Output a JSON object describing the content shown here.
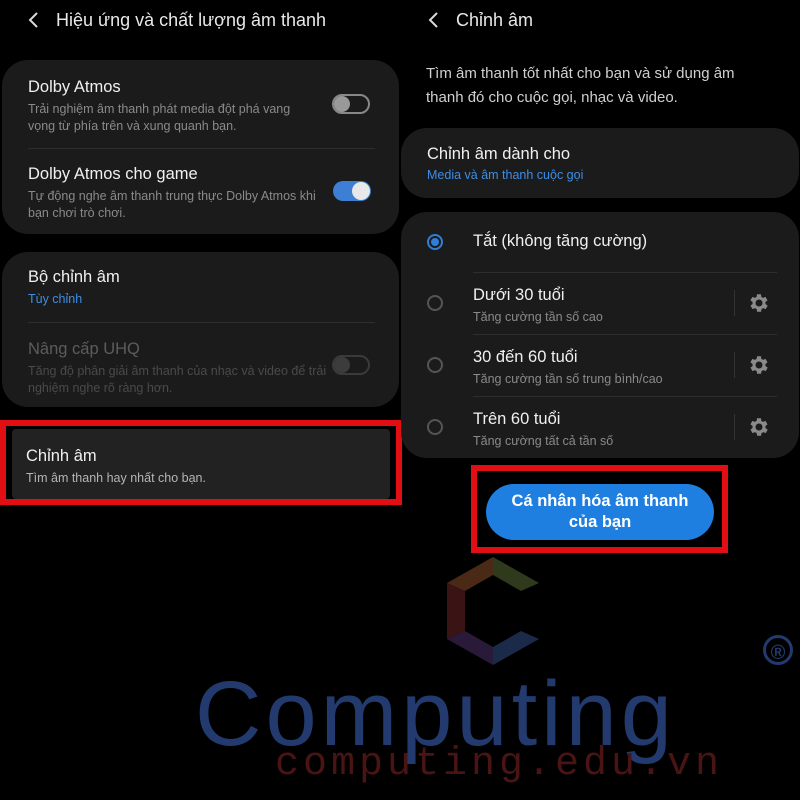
{
  "left": {
    "header": {
      "title": "Hiệu ứng và chất lượng âm thanh"
    },
    "dolby_card": {
      "items": [
        {
          "title": "Dolby Atmos",
          "subtitle": "Trải nghiệm âm thanh phát media đột phá vang vọng từ phía trên và xung quanh bạn.",
          "toggle": "off"
        },
        {
          "title": "Dolby Atmos cho game",
          "subtitle": "Tự động nghe âm thanh trung thực Dolby Atmos khi bạn chơi trò chơi.",
          "toggle": "on"
        }
      ]
    },
    "eq_card": {
      "items": [
        {
          "title": "Bộ chỉnh âm",
          "value": "Tùy chỉnh"
        },
        {
          "title": "Nâng cấp UHQ",
          "subtitle": "Tăng độ phân giải âm thanh của nhạc và video để trải nghiệm nghe rõ ràng hơn.",
          "toggle": "disabled"
        }
      ]
    },
    "highlight_item": {
      "title": "Chỉnh âm",
      "subtitle": "Tìm âm thanh hay nhất cho bạn."
    }
  },
  "right": {
    "header": {
      "title": "Chỉnh âm"
    },
    "description": "Tìm âm thanh tốt nhất cho bạn và sử dụng âm thanh đó cho cuộc gọi, nhạc và video.",
    "target_card": {
      "title": "Chỉnh âm dành cho",
      "value": "Media và âm thanh cuộc gọi"
    },
    "options": [
      {
        "label": "Tắt (không tăng cường)",
        "selected": true
      },
      {
        "label": "Dưới 30 tuổi",
        "subtitle": "Tăng cường tần số cao",
        "selected": false
      },
      {
        "label": "30 đến 60 tuổi",
        "subtitle": "Tăng cường tần số trung bình/cao",
        "selected": false
      },
      {
        "label": "Trên 60 tuổi",
        "subtitle": "Tăng cường tất cả tần số",
        "selected": false
      }
    ],
    "personalize_button": "Cá nhân hóa âm thanh của bạn"
  },
  "watermark": {
    "brand": "Computing",
    "registered": "®",
    "url": "computing.edu.vn"
  },
  "colors": {
    "accent": "#1e7fe0",
    "highlight_frame": "#e10f14",
    "card": "#1b1b1b",
    "watermark_blue": "#233a6e"
  },
  "icons": {
    "back": "chevron-left-icon",
    "settings": "gear-icon"
  }
}
